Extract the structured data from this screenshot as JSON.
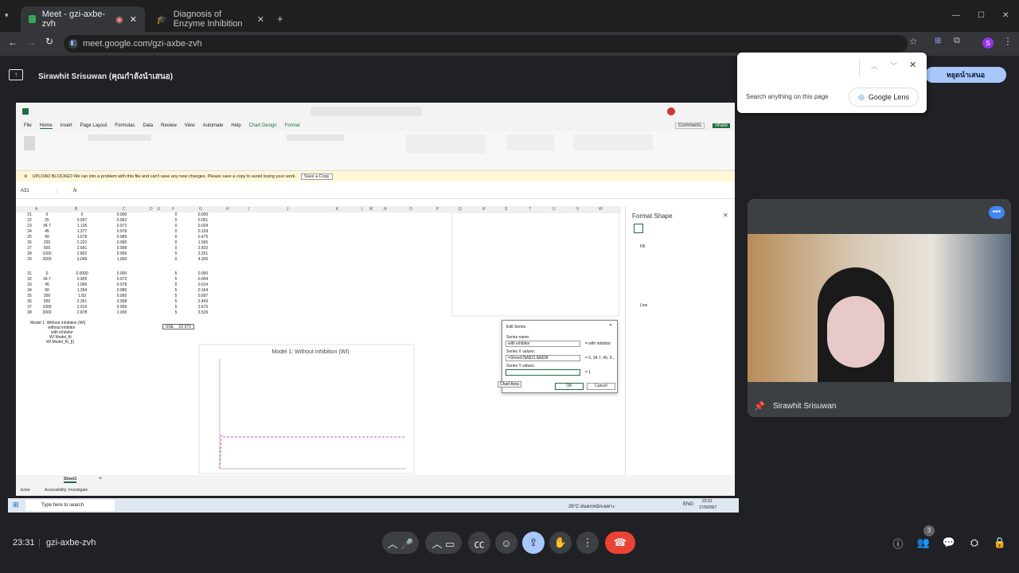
{
  "browser": {
    "tabs": [
      {
        "label": "Meet - gzi-axbe-zvh",
        "active": true
      },
      {
        "label": "Diagnosis of Enzyme Inhibition",
        "active": false
      }
    ],
    "url": "meet.google.com/gzi-axbe-zvh",
    "new_tab": "+",
    "profile_initial": "S"
  },
  "presenting_banner": {
    "title": "Sirawhit Srisuwan (คุณกำลังนำเสนอ)",
    "stop_button": "หยุดนำเสนอ"
  },
  "find_bar": {
    "hint": "Search anything on this page",
    "lens_button": "Google Lens"
  },
  "excel": {
    "menu": [
      "File",
      "Home",
      "Insert",
      "Page Layout",
      "Formulas",
      "Data",
      "Review",
      "View",
      "Automate",
      "Help",
      "Chart Design",
      "Format"
    ],
    "warning": "UPLOAD BLOCKED  We ran into a problem with this file and can't save any new changes. Please save a copy to avoid losing your work.",
    "save_copy": "Save a Copy",
    "name_box": "A31",
    "comments": "Comments",
    "share": "Share",
    "columns": [
      "A",
      "B",
      "C",
      "D",
      "E",
      "F",
      "G",
      "H",
      "I",
      "J",
      "K",
      "L",
      "M",
      "N",
      "O",
      "P",
      "Q",
      "R",
      "S",
      "T",
      "U",
      "V",
      "W"
    ],
    "rows_block1": [
      [
        "21",
        "0",
        "0",
        "0.000",
        "0",
        "0.000"
      ],
      [
        "22",
        "25",
        "0.937",
        "0.962",
        "0",
        "0.001"
      ],
      [
        "23",
        "34.7",
        "1.126",
        "0.972",
        "0",
        "0.024"
      ],
      [
        "24",
        "45",
        "1.377",
        "0.978",
        "0",
        "0.159"
      ],
      [
        "25",
        "90",
        "1.678",
        "0.989",
        "0",
        "0.475"
      ],
      [
        "26",
        "200",
        "2.222",
        "0.995",
        "0",
        "1.565"
      ],
      [
        "27",
        "500",
        "2.681",
        "0.998",
        "0",
        "2.832"
      ],
      [
        "28",
        "1000",
        "2.802",
        "0.999",
        "0",
        "3.251"
      ],
      [
        "29",
        "2000",
        "3.049",
        "1.000",
        "0",
        "4.200"
      ]
    ],
    "rows_block2": [
      [
        "31",
        "0",
        "0.0000",
        "0.000",
        "5",
        "0.000"
      ],
      [
        "32",
        "34.7",
        "0.905",
        "0.972",
        "5",
        "0.004"
      ],
      [
        "33",
        "45",
        "1.095",
        "0.978",
        "5",
        "0.014"
      ],
      [
        "34",
        "90",
        "1.394",
        "0.989",
        "5",
        "0.164"
      ],
      [
        "35",
        "200",
        "1.83",
        "0.995",
        "5",
        "0.697"
      ],
      [
        "36",
        "500",
        "2.361",
        "0.998",
        "5",
        "2.443"
      ],
      [
        "37",
        "1000",
        "2.916",
        "0.999",
        "5",
        "3.675"
      ],
      [
        "38",
        "2000",
        "2.878",
        "1.000",
        "5",
        "3.529"
      ]
    ],
    "sse_label": "SSE",
    "sse_value": "22.973",
    "legend_rows": [
      "Model 1: Without inhibition (WI)",
      "without inhibitor",
      "with inhibitor",
      "WI Model_fit",
      "WI Model_fit_[I]"
    ],
    "chart_title": "Model 1: Without inhibition (WI)",
    "sheet_tab": "Sheet1",
    "status_left": "Enter",
    "status_accessibility": "Accessibility: Investigate",
    "format_pane": {
      "title": "Format Shape",
      "fill": "Fill",
      "line": "Line"
    },
    "edit_series": {
      "title": "Edit Series",
      "name_label": "Series name:",
      "name_value": "with inhibitor",
      "name_preview": "= with inhibitor",
      "x_label": "Series X values:",
      "x_value": "=Sheet1!$A$31:$A$38",
      "x_preview": "= 0, 34.7, 45, 9...",
      "y_label": "Series Y values:",
      "y_preview": "= 1",
      "ok": "OK",
      "cancel": "Cancel",
      "tooltip": "Chart Area"
    }
  },
  "windows_taskbar": {
    "search": "Type here to search",
    "weather": "26°C ฝนตกหนักเฉพาะ",
    "lang": "ENG",
    "time": "23:31",
    "date": "17/9/2567"
  },
  "participant": {
    "name": "Sirawhit Srisuwan"
  },
  "meet_bottom": {
    "time": "23:31",
    "meeting_code": "gzi-axbe-zvh",
    "people_count": "3"
  }
}
